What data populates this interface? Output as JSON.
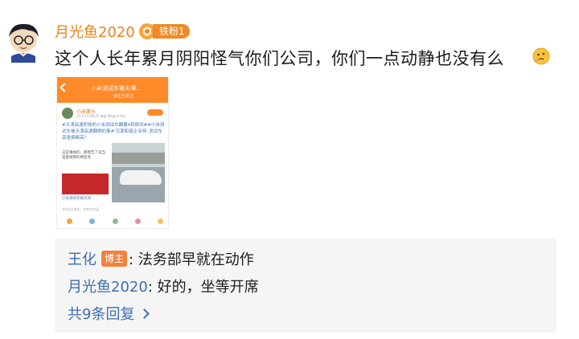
{
  "comment": {
    "author": "月光鱼2020",
    "fan_badge": "铁粉1",
    "text": "这个人长年累月阴阳怪气你们公司，你们一点动静也没有么"
  },
  "thumbnail": {
    "title": "小米测试车被夭谭...",
    "subtitle": "博主已关注",
    "post_author": "小麻薯乐",
    "post_meta": "24-5-10 08:22  来自 Magicd Pro",
    "post_text": "#天津高速积极的小米测试车翻覆4和倒伐##小米测试车被天津高速翻倒的事#'汉源和谐企业特'.测试车高速费都高？",
    "left_text": "这是事故的，那我告了说当是着保那的费后务",
    "link_text": "小米测试车被天津...",
    "footer": "4明友出来的，你有空你运"
  },
  "replies": [
    {
      "name": "王化",
      "badge": "博主",
      "text": ": 法务部早就在动作"
    },
    {
      "name": "月光鱼2020",
      "badge": "",
      "text": ": 好的，坐等开席"
    }
  ],
  "more_replies": "共9条回复"
}
